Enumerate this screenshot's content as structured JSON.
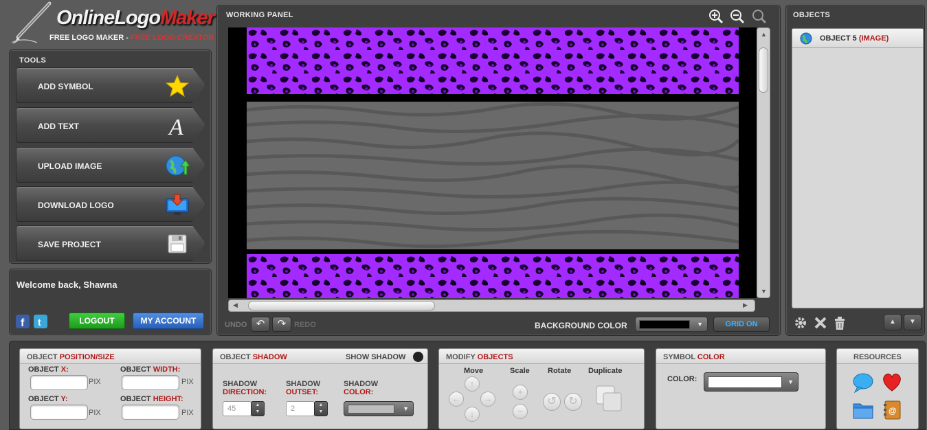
{
  "logo": {
    "brand_part1": "OnlineLogo",
    "brand_part2": "Maker",
    "tagline_part1": "FREE LOGO MAKER - ",
    "tagline_part2": "FREE LOGO CREATOR"
  },
  "tools": {
    "title": "TOOLS",
    "items": [
      {
        "label": "ADD SYMBOL",
        "icon": "star-icon"
      },
      {
        "label": "ADD TEXT",
        "icon": "text-a-icon"
      },
      {
        "label": "UPLOAD IMAGE",
        "icon": "globe-upload-icon"
      },
      {
        "label": "DOWNLOAD LOGO",
        "icon": "monitor-download-icon"
      },
      {
        "label": "SAVE PROJECT",
        "icon": "floppy-disk-icon"
      }
    ]
  },
  "welcome": {
    "message": "Welcome back, Shawna",
    "logout_label": "LOGOUT",
    "account_label": "MY ACCOUNT"
  },
  "working_panel": {
    "title": "WORKING PANEL",
    "undo_label": "UNDO",
    "redo_label": "REDO",
    "bg_color_label": "BACKGROUND COLOR",
    "bg_color_value": "#000000",
    "grid_label": "GRID ON"
  },
  "objects_panel": {
    "title": "OBJECTS",
    "items": [
      {
        "name": "OBJECT 5",
        "type": "(IMAGE)",
        "icon": "globe-icon"
      }
    ]
  },
  "position_size": {
    "title_part1": "OBJECT ",
    "title_part2": "POSITION/SIZE",
    "x_label1": "OBJECT ",
    "x_label2": "X:",
    "width_label1": "OBJECT ",
    "width_label2": "WIDTH:",
    "y_label1": "OBJECT ",
    "y_label2": "Y:",
    "height_label1": "OBJECT ",
    "height_label2": "HEIGHT:",
    "unit": "PIX",
    "x": "",
    "y": "",
    "width": "",
    "height": ""
  },
  "shadow": {
    "title_part1": "OBJECT ",
    "title_part2": "SHADOW",
    "show_label": "SHOW SHADOW",
    "direction_label1": "SHADOW",
    "direction_label2": "DIRECTION:",
    "outset_label1": "SHADOW",
    "outset_label2": "OUTSET:",
    "color_label1": "SHADOW",
    "color_label2": "COLOR:",
    "direction_value": "45",
    "outset_value": "2"
  },
  "modify": {
    "title_part1": "MODIFY ",
    "title_part2": "OBJECTS",
    "move_label": "Move",
    "scale_label": "Scale",
    "rotate_label": "Rotate",
    "duplicate_label": "Duplicate"
  },
  "symbol_color": {
    "title_part1": "SYMBOL ",
    "title_part2": "COLOR",
    "color_label": "COLOR:"
  },
  "resources": {
    "title": "RESOURCES",
    "icons": [
      "speech-bubble-icon",
      "heart-icon",
      "folder-icon",
      "address-book-icon"
    ]
  },
  "colors": {
    "accent_red": "#b01818",
    "grid_blue": "#3db6ff",
    "leopard_purple": "#a020ff"
  }
}
